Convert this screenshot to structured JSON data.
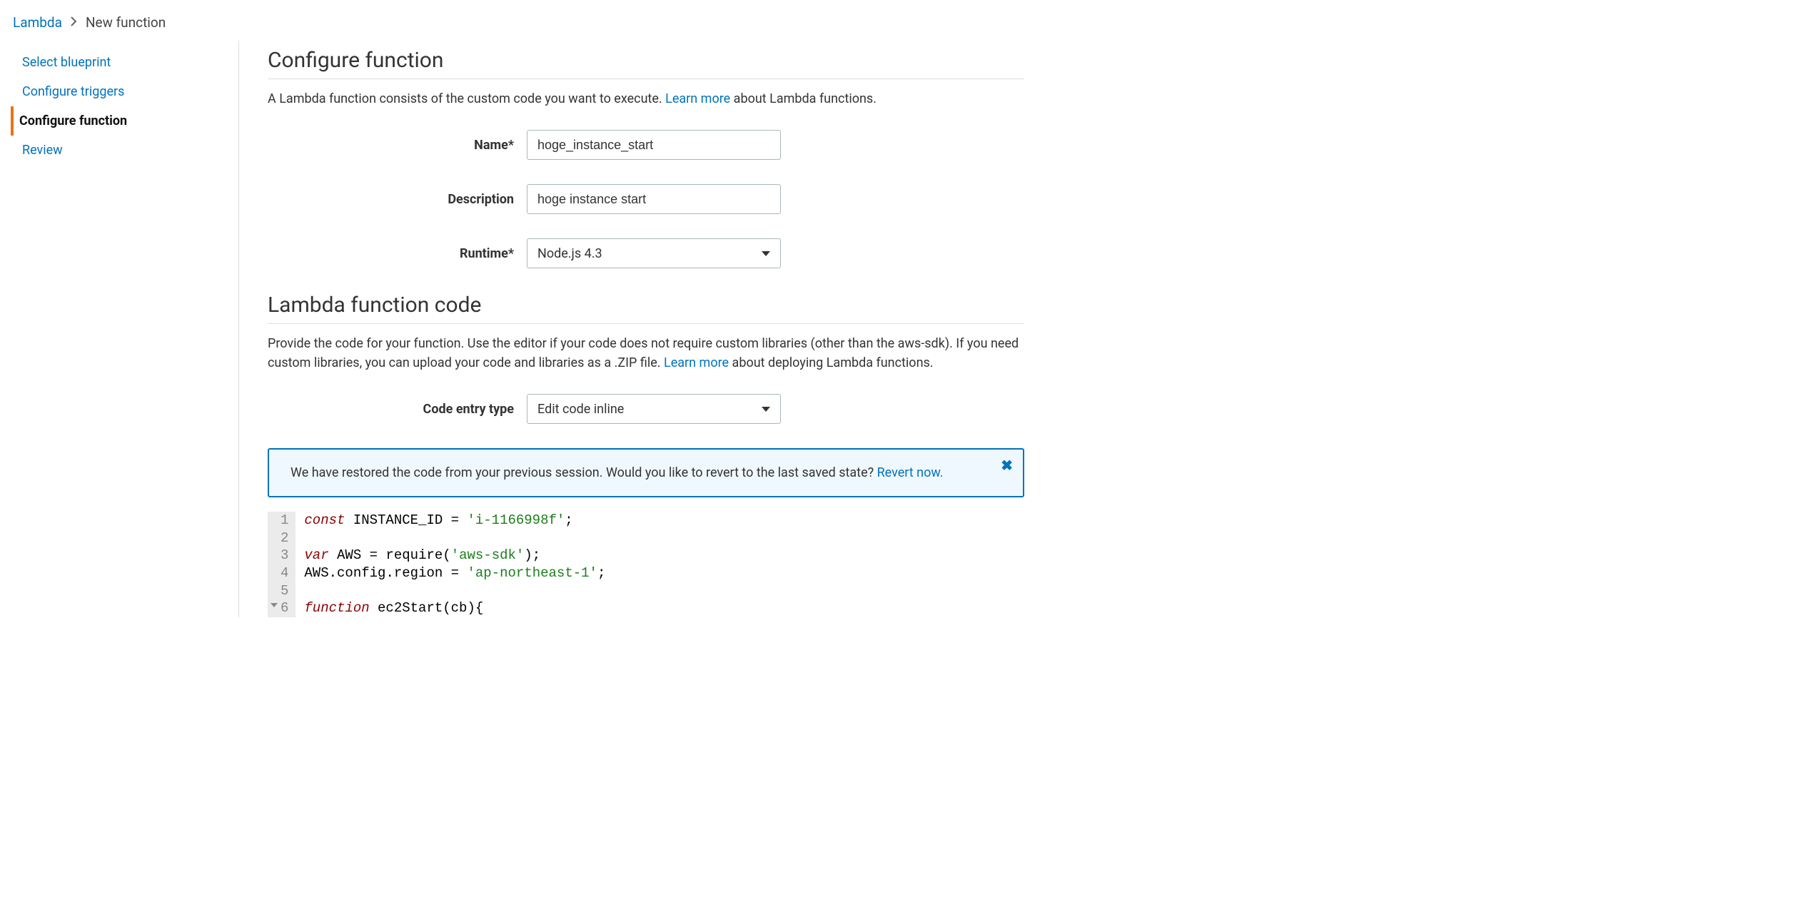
{
  "breadcrumb": {
    "root": "Lambda",
    "current": "New function"
  },
  "sidebar": {
    "items": [
      {
        "label": "Select blueprint"
      },
      {
        "label": "Configure triggers"
      },
      {
        "label": "Configure function"
      },
      {
        "label": "Review"
      }
    ]
  },
  "configure": {
    "title": "Configure function",
    "desc_before": "A Lambda function consists of the custom code you want to execute. ",
    "learn_more": "Learn more",
    "desc_after": " about Lambda functions.",
    "name_label": "Name*",
    "name_value": "hoge_instance_start",
    "description_label": "Description",
    "description_value": "hoge instance start",
    "runtime_label": "Runtime*",
    "runtime_value": "Node.js 4.3"
  },
  "code_section": {
    "title": "Lambda function code",
    "desc_before": "Provide the code for your function. Use the editor if your code does not require custom libraries (other than the aws-sdk). If you need custom libraries, you can upload your code and libraries as a .ZIP file. ",
    "learn_more": "Learn more",
    "desc_after": " about deploying Lambda functions.",
    "entry_label": "Code entry type",
    "entry_value": "Edit code inline"
  },
  "alert": {
    "text": "We have restored the code from your previous session. Would you like to revert to the last saved state? ",
    "link": "Revert now."
  },
  "code": {
    "lines": [
      "1",
      "2",
      "3",
      "4",
      "5",
      "6"
    ],
    "l1": {
      "const": "const",
      "id": "INSTANCE_ID",
      "eq": " = ",
      "str": "'i-1166998f'",
      "semi": ";"
    },
    "l3": {
      "var": "var",
      "id": "AWS",
      "eq": " = ",
      "req": "require",
      "open": "(",
      "str": "'aws-sdk'",
      "close": ")",
      "semi": ";"
    },
    "l4": {
      "id1": "AWS",
      "dot1": ".",
      "id2": "config",
      "dot2": ".",
      "id3": "region",
      "eq": " = ",
      "str": "'ap-northeast-1'",
      "semi": ";"
    },
    "l6": {
      "func": "function",
      "name": "ec2Start",
      "open": "(",
      "arg": "cb",
      "close": ")",
      "brace": "{"
    }
  }
}
